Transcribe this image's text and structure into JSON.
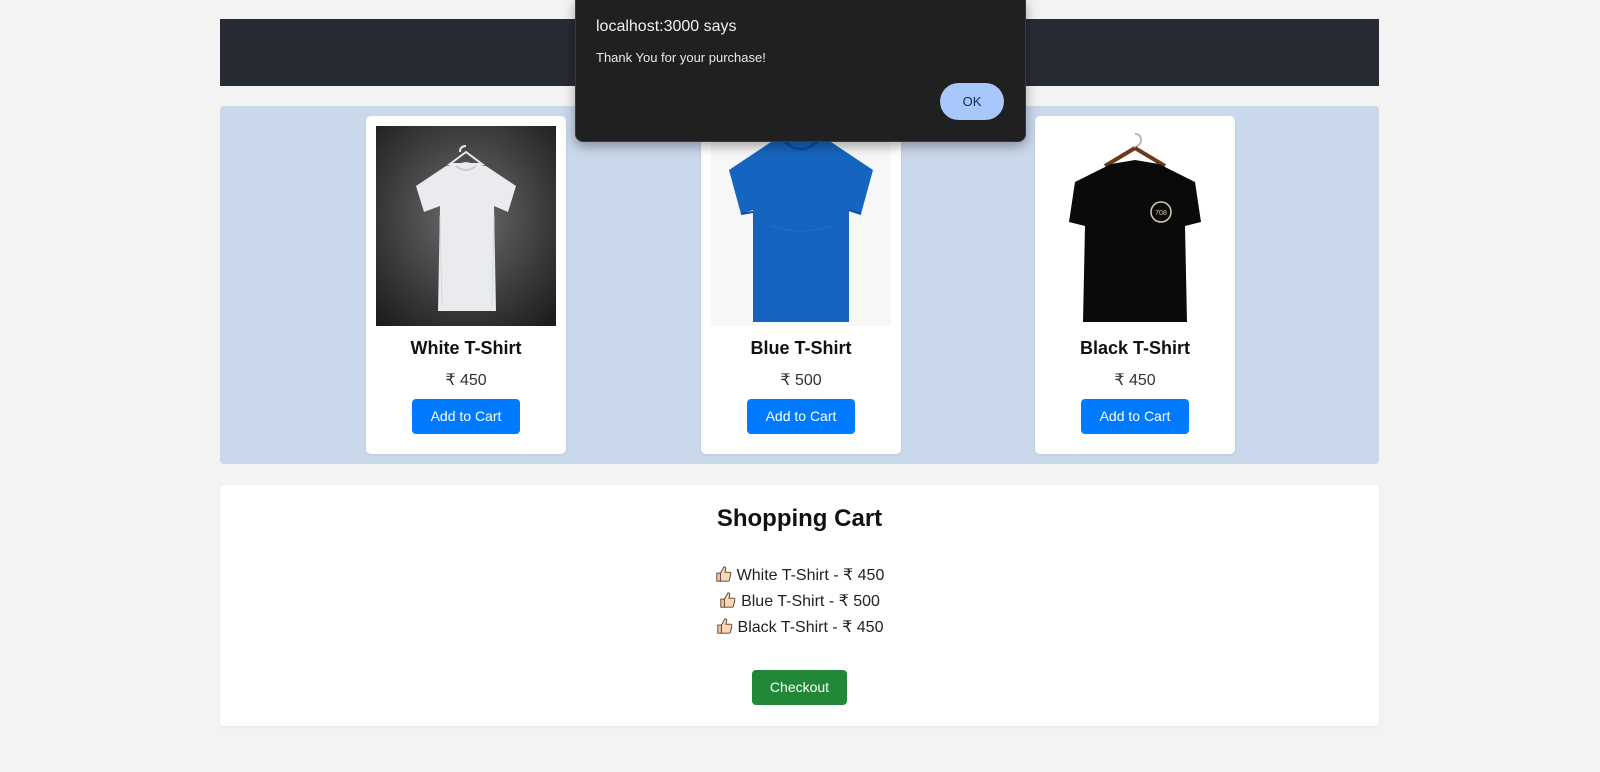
{
  "products": [
    {
      "name": "White T-Shirt",
      "price": "₹ 450",
      "button": "Add to Cart",
      "image": "white-tshirt-on-hanger"
    },
    {
      "name": "Blue T-Shirt",
      "price": "₹ 500",
      "button": "Add to Cart",
      "image": "blue-tshirt"
    },
    {
      "name": "Black T-Shirt",
      "price": "₹ 450",
      "button": "Add to Cart",
      "image": "black-tshirt-on-hanger"
    }
  ],
  "cart": {
    "title": "Shopping Cart",
    "items": [
      {
        "text": "White T-Shirt - ₹ 450",
        "icon": "thumbs-up-icon"
      },
      {
        "text": "Blue T-Shirt - ₹ 500",
        "icon": "thumbs-up-icon"
      },
      {
        "text": "Black T-Shirt - ₹ 450",
        "icon": "thumbs-up-icon"
      }
    ],
    "checkout_label": "Checkout"
  },
  "dialog": {
    "title": "localhost:3000 says",
    "message": "Thank You for your purchase!",
    "ok_label": "OK"
  },
  "colors": {
    "header": "#272b34",
    "product_area": "#cad8ec",
    "primary_button": "#007bff",
    "checkout_button": "#218838",
    "dialog_bg": "#202020",
    "dialog_ok": "#a8c7fa"
  }
}
